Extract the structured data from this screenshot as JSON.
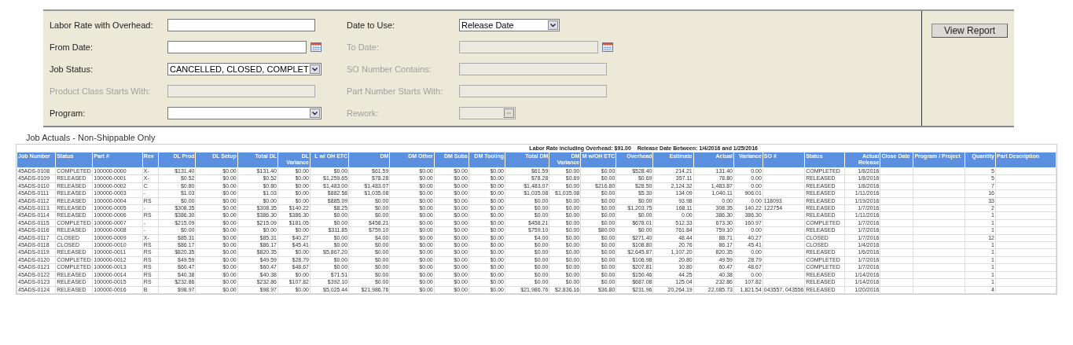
{
  "form": {
    "fields": [
      {
        "label": "Labor Rate with Overhead:",
        "kind": "text",
        "disabled": false
      },
      {
        "label": "Date to Use:",
        "kind": "select",
        "value": "Release Date",
        "disabled": false
      },
      {
        "label": "From Date:",
        "kind": "date",
        "disabled": false
      },
      {
        "label": "To Date:",
        "kind": "date",
        "disabled": true
      },
      {
        "label": "Job Status:",
        "kind": "multiselect",
        "value": "CANCELLED, CLOSED, COMPLET",
        "disabled": false
      },
      {
        "label": "SO Number Contains:",
        "kind": "text",
        "disabled": true
      },
      {
        "label": "Product Class Starts With:",
        "kind": "text",
        "disabled": true
      },
      {
        "label": "Part Number Starts With:",
        "kind": "text",
        "disabled": true
      },
      {
        "label": "Program:",
        "kind": "multiselect",
        "disabled": false
      },
      {
        "label": "Rework:",
        "kind": "select",
        "disabled": true
      }
    ],
    "button": "View Report"
  },
  "report": {
    "title": "Job Actuals - Non-Shippable Only",
    "caption": "Labor Rate including Overhead: $91.00    Release Date Between: 1/4/2016 and 1/25/2016",
    "columns": [
      "Job Number",
      "Status",
      "Part #",
      "Rev",
      "DL Prod",
      "DL Setup",
      "Total DL",
      "DL Variance",
      "L w/ OH ETC",
      "DM",
      "DM Other",
      "DM Subs",
      "DM Tooling",
      "Total DM",
      "DM Variance",
      "M w/OH ETC",
      "Overhead",
      "Estimate",
      "Actual",
      "Variance",
      "SO #",
      "Status",
      "Actual Release",
      "Close Date",
      "Program / Project",
      "Quantity",
      "Part Description"
    ],
    "rows": [
      [
        "45ADS-0108",
        "COMPLETED",
        "100000-0000",
        "X-",
        "$131.40",
        "$0.00",
        "$131.40",
        "$0.00",
        "$0.00",
        "$61.59",
        "$0.00",
        "$0.00",
        "$0.00",
        "$61.59",
        "$0.00",
        "$0.00",
        "$528.40",
        "214.21",
        "131.40",
        "0.00",
        "",
        "COMPLETED",
        "1/8/2016",
        "",
        "",
        "5",
        ""
      ],
      [
        "45ADS-0109",
        "RELEASED",
        "100000-0001",
        "X-",
        "$0.52",
        "$0.00",
        "$0.52",
        "$0.00",
        "$1,259.65",
        "$78.28",
        "$0.00",
        "$0.00",
        "$0.00",
        "$78.28",
        "$0.69",
        "$0.00",
        "$0.69",
        "357.11",
        "78.80",
        "0.00",
        "",
        "RELEASED",
        "1/8/2016",
        "",
        "",
        "5",
        ""
      ],
      [
        "45ADS-0110",
        "RELEASED",
        "100000-0002",
        "C",
        "$0.80",
        "$0.00",
        "$0.80",
        "$0.00",
        "$1,483.00",
        "$1,483.07",
        "$0.00",
        "$0.00",
        "$0.00",
        "$1,483.07",
        "$0.00",
        "$216.80",
        "$28.50",
        "2,124.32",
        "1,483.87",
        "0.00",
        "",
        "RELEASED",
        "1/8/2016",
        "",
        "",
        "7",
        ""
      ],
      [
        "45ADS-0111",
        "RELEASED",
        "100000-0003",
        "-",
        "$1.03",
        "$0.00",
        "$1.03",
        "$0.00",
        "$882.58",
        "$1,035.08",
        "$0.00",
        "$0.00",
        "$0.00",
        "$1,035.08",
        "$1,035.08",
        "$0.00",
        "$5.30",
        "134.09",
        "1,040.11",
        "906.01",
        "",
        "RELEASED",
        "1/11/2016",
        "",
        "",
        "16",
        ""
      ],
      [
        "45ADS-0112",
        "RELEASED",
        "100000-0004",
        "RS",
        "$0.00",
        "$0.00",
        "$0.00",
        "$0.00",
        "$885.09",
        "$0.00",
        "$0.00",
        "$0.00",
        "$0.00",
        "$0.00",
        "$0.00",
        "$0.00",
        "$0.00",
        "93.98",
        "0.00",
        "0.00",
        "118093",
        "RELEASED",
        "1/19/2016",
        "",
        "",
        "33",
        ""
      ],
      [
        "45ADS-0113",
        "RELEASED",
        "100000-0005",
        "-",
        "$308.35",
        "$0.00",
        "$308.35",
        "$140.22",
        "$8.25",
        "$0.00",
        "$0.00",
        "$0.00",
        "$0.00",
        "$0.00",
        "$0.00",
        "$0.00",
        "$1,203.75",
        "168.11",
        "308.35",
        "140.22",
        "122754",
        "RELEASED",
        "1/7/2016",
        "",
        "",
        "2",
        ""
      ],
      [
        "45ADS-0114",
        "RELEASED",
        "100000-0006",
        "RS",
        "$386.30",
        "$0.00",
        "$386.30",
        "$386.30",
        "$0.00",
        "$0.00",
        "$0.00",
        "$0.00",
        "$0.00",
        "$0.00",
        "$0.00",
        "$0.00",
        "$0.00",
        "0.00",
        "386.30",
        "386.30",
        "",
        "RELEASED",
        "1/11/2016",
        "",
        "",
        "1",
        ""
      ],
      [
        "45ADS-0115",
        "COMPLETED",
        "100000-0007",
        "-",
        "$215.09",
        "$0.00",
        "$215.09",
        "$181.05",
        "$0.00",
        "$458.21",
        "$0.00",
        "$0.00",
        "$0.00",
        "$458.21",
        "$0.00",
        "$0.00",
        "$678.01",
        "512.33",
        "673.30",
        "160.97",
        "",
        "COMPLETED",
        "1/7/2016",
        "",
        "",
        "1",
        ""
      ],
      [
        "45ADS-0116",
        "RELEASED",
        "100000-0008",
        "-",
        "$0.00",
        "$0.00",
        "$0.00",
        "$0.00",
        "$311.85",
        "$759.10",
        "$0.00",
        "$0.00",
        "$0.00",
        "$759.10",
        "$0.00",
        "$80.00",
        "$0.00",
        "761.84",
        "759.10",
        "0.00",
        "",
        "RELEASED",
        "1/7/2016",
        "",
        "",
        "1",
        ""
      ],
      [
        "45ADS-0117",
        "CLOSED",
        "100000-0009",
        "X-",
        "$85.31",
        "$0.00",
        "$85.31",
        "$40.27",
        "$0.00",
        "$4.00",
        "$0.00",
        "$0.00",
        "$0.00",
        "$4.00",
        "$0.00",
        "$0.00",
        "$271.40",
        "48.44",
        "88.71",
        "40.27",
        "",
        "CLOSED",
        "1/7/2016",
        "",
        "",
        "12",
        ""
      ],
      [
        "45ADS-0118",
        "CLOSED",
        "100000-0010",
        "RS",
        "$86.17",
        "$0.00",
        "$86.17",
        "$45.41",
        "$0.00",
        "$0.00",
        "$0.00",
        "$0.00",
        "$0.00",
        "$0.00",
        "$0.00",
        "$0.00",
        "$108.80",
        "20.76",
        "86.17",
        "45.41",
        "",
        "CLOSED",
        "1/4/2016",
        "",
        "",
        "1",
        ""
      ],
      [
        "45ADS-0119",
        "RELEASED",
        "100000-0011",
        "RS",
        "$820.35",
        "$0.00",
        "$820.35",
        "$0.00",
        "$5,867.20",
        "$0.00",
        "$0.00",
        "$0.00",
        "$0.00",
        "$0.00",
        "$0.00",
        "$0.00",
        "$2,645.87",
        "1,107.20",
        "820.35",
        "0.00",
        "",
        "RELEASED",
        "1/6/2016",
        "",
        "",
        "1",
        ""
      ],
      [
        "45ADS-0120",
        "COMPLETED",
        "100000-0012",
        "RS",
        "$49.59",
        "$0.00",
        "$49.59",
        "$28.79",
        "$0.00",
        "$0.00",
        "$0.00",
        "$0.00",
        "$0.00",
        "$0.00",
        "$0.00",
        "$0.00",
        "$106.98",
        "20.80",
        "49.59",
        "28.79",
        "",
        "COMPLETED",
        "1/7/2016",
        "",
        "",
        "1",
        ""
      ],
      [
        "45ADS-0121",
        "COMPLETED",
        "100000-0013",
        "RS",
        "$60.47",
        "$0.00",
        "$60.47",
        "$48.67",
        "$0.00",
        "$0.00",
        "$0.00",
        "$0.00",
        "$0.00",
        "$0.00",
        "$0.00",
        "$0.00",
        "$207.81",
        "10.80",
        "60.47",
        "48.67",
        "",
        "COMPLETED",
        "1/7/2016",
        "",
        "",
        "1",
        ""
      ],
      [
        "45ADS-0122",
        "RELEASED",
        "100000-0014",
        "RS",
        "$40.38",
        "$0.00",
        "$40.38",
        "$0.00",
        "$71.51",
        "$0.00",
        "$0.00",
        "$0.00",
        "$0.00",
        "$0.00",
        "$0.00",
        "$0.00",
        "$150.46",
        "44.25",
        "40.38",
        "0.00",
        "",
        "RELEASED",
        "1/14/2016",
        "",
        "",
        "1",
        ""
      ],
      [
        "45ADS-0123",
        "RELEASED",
        "100000-0015",
        "RS",
        "$232.86",
        "$0.00",
        "$232.86",
        "$107.82",
        "$392.10",
        "$0.00",
        "$0.00",
        "$0.00",
        "$0.00",
        "$0.00",
        "$0.00",
        "$0.00",
        "$687.08",
        "125.04",
        "232.86",
        "107.82",
        "",
        "RELEASED",
        "1/14/2016",
        "",
        "",
        "1",
        ""
      ],
      [
        "45ADS-0124",
        "RELEASED",
        "100000-0016",
        "B",
        "$98.97",
        "$0.00",
        "$98.97",
        "$0.00",
        "$5,025.44",
        "$21,986.76",
        "$0.00",
        "$0.00",
        "$0.00",
        "$21,986.76",
        "$2,836.16",
        "$36.80",
        "$231.96",
        "20,264.19",
        "22,085.73",
        "1,821.54",
        "043557, 043556",
        "RELEASED",
        "1/20/2016",
        "",
        "",
        "4",
        ""
      ]
    ]
  }
}
